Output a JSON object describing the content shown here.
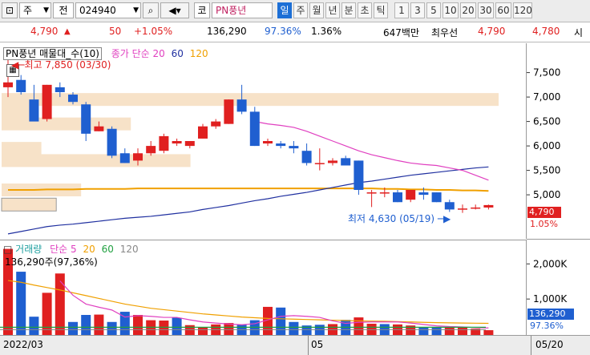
{
  "toolbar": {
    "mode": "주",
    "mode_alt": "전",
    "code": "024940",
    "market": "코",
    "name": "PN풍년",
    "periods": [
      "일",
      "주",
      "월",
      "년",
      "분",
      "초",
      "틱"
    ],
    "active_period": "일",
    "intervals": [
      "1",
      "3",
      "5",
      "10",
      "20",
      "30",
      "60",
      "120"
    ]
  },
  "info": {
    "price": "4,790",
    "change": "50",
    "change_pct": "+1.05%",
    "volume": "136,290",
    "vol_ratio": "97.36%",
    "turnover_pct": "1.36%",
    "amount": "647백만",
    "best_ask_label": "최우선",
    "ask": "4,790",
    "bid": "4,780",
    "more": "시"
  },
  "price_legend": {
    "title": "PN풍년 매물대_수(10)",
    "ma_label": "종가 단순",
    "ma_periods": [
      "20",
      "60",
      "120"
    ],
    "max_annotation": "최고 7,850 (03/30)",
    "min_annotation": "최저 4,630 (05/19)",
    "current_price": "4,790",
    "current_pct": "1.05%"
  },
  "volume_legend": {
    "title": "거래량",
    "ma_label": "단순",
    "ma_periods": [
      "5",
      "20",
      "60",
      "120"
    ],
    "value": "136,290주(97,36%)",
    "current": "136,290",
    "current_pct": "97.36%"
  },
  "dates": {
    "start": "2022/03",
    "mid": "05",
    "end": "05/20"
  },
  "colors": {
    "up": "#e02020",
    "down": "#1f5fd0",
    "ma20": "#e040c0",
    "ma60": "#2030a0",
    "ma120": "#f0a000",
    "profile": "#f7e2c8"
  },
  "chart_data": [
    {
      "type": "candlestick",
      "title": "PN풍년 매물대_수(10)",
      "ylim": [
        4100,
        8100
      ],
      "y_ticks": [
        7500,
        7000,
        6500,
        6000,
        5500,
        5000
      ],
      "candles": [
        {
          "o": 7200,
          "h": 7850,
          "l": 7000,
          "c": 7300
        },
        {
          "o": 7350,
          "h": 7450,
          "l": 7050,
          "c": 7100
        },
        {
          "o": 6950,
          "h": 7250,
          "l": 6950,
          "c": 6500
        },
        {
          "o": 6550,
          "h": 7250,
          "l": 6500,
          "c": 7250
        },
        {
          "o": 7200,
          "h": 7300,
          "l": 7000,
          "c": 7100
        },
        {
          "o": 7050,
          "h": 7100,
          "l": 6850,
          "c": 6900
        },
        {
          "o": 6850,
          "h": 6900,
          "l": 6100,
          "c": 6250
        },
        {
          "o": 6300,
          "h": 6500,
          "l": 6300,
          "c": 6400
        },
        {
          "o": 6350,
          "h": 6400,
          "l": 5750,
          "c": 5800
        },
        {
          "o": 5850,
          "h": 5950,
          "l": 5650,
          "c": 5650
        },
        {
          "o": 5700,
          "h": 5950,
          "l": 5600,
          "c": 5850
        },
        {
          "o": 5850,
          "h": 6100,
          "l": 5800,
          "c": 6000
        },
        {
          "o": 5900,
          "h": 6250,
          "l": 5850,
          "c": 6200
        },
        {
          "o": 6050,
          "h": 6150,
          "l": 6000,
          "c": 6100
        },
        {
          "o": 6000,
          "h": 6100,
          "l": 5950,
          "c": 6100
        },
        {
          "o": 6150,
          "h": 6450,
          "l": 6150,
          "c": 6400
        },
        {
          "o": 6400,
          "h": 6550,
          "l": 6350,
          "c": 6500
        },
        {
          "o": 6450,
          "h": 6950,
          "l": 6450,
          "c": 6950
        },
        {
          "o": 6950,
          "h": 7250,
          "l": 6650,
          "c": 6700
        },
        {
          "o": 6700,
          "h": 6800,
          "l": 6000,
          "c": 6000
        },
        {
          "o": 6050,
          "h": 6150,
          "l": 6000,
          "c": 6100
        },
        {
          "o": 6050,
          "h": 6100,
          "l": 5950,
          "c": 6000
        },
        {
          "o": 6000,
          "h": 6100,
          "l": 5850,
          "c": 5950
        },
        {
          "o": 5900,
          "h": 6050,
          "l": 5600,
          "c": 5650
        },
        {
          "o": 5650,
          "h": 5950,
          "l": 5500,
          "c": 5650
        },
        {
          "o": 5650,
          "h": 5750,
          "l": 5600,
          "c": 5700
        },
        {
          "o": 5750,
          "h": 5800,
          "l": 5600,
          "c": 5600
        },
        {
          "o": 5700,
          "h": 5700,
          "l": 5000,
          "c": 5100
        },
        {
          "o": 5050,
          "h": 5100,
          "l": 4750,
          "c": 5050
        },
        {
          "o": 5050,
          "h": 5150,
          "l": 4950,
          "c": 5050
        },
        {
          "o": 5050,
          "h": 5100,
          "l": 4850,
          "c": 4850
        },
        {
          "o": 4900,
          "h": 5100,
          "l": 4850,
          "c": 5100
        },
        {
          "o": 5050,
          "h": 5150,
          "l": 4900,
          "c": 5000
        },
        {
          "o": 5050,
          "h": 5050,
          "l": 4850,
          "c": 4850
        },
        {
          "o": 4850,
          "h": 4900,
          "l": 4650,
          "c": 4700
        },
        {
          "o": 4700,
          "h": 4800,
          "l": 4630,
          "c": 4720
        },
        {
          "o": 4720,
          "h": 4800,
          "l": 4700,
          "c": 4740
        },
        {
          "o": 4740,
          "h": 4800,
          "l": 4700,
          "c": 4790
        }
      ],
      "ma20": [
        null,
        null,
        null,
        null,
        null,
        null,
        null,
        null,
        null,
        null,
        null,
        null,
        null,
        null,
        null,
        null,
        null,
        null,
        null,
        6500,
        6450,
        6420,
        6380,
        6300,
        6200,
        6100,
        6000,
        5900,
        5820,
        5760,
        5700,
        5650,
        5620,
        5600,
        5550,
        5500,
        5400,
        5300
      ],
      "ma60": [
        4200,
        4250,
        4300,
        4350,
        4380,
        4400,
        4430,
        4460,
        4490,
        4520,
        4540,
        4560,
        4590,
        4620,
        4650,
        4700,
        4740,
        4780,
        4830,
        4880,
        4920,
        4970,
        5010,
        5050,
        5100,
        5150,
        5200,
        5250,
        5280,
        5320,
        5360,
        5400,
        5430,
        5460,
        5490,
        5520,
        5550,
        5570
      ],
      "ma120": [
        5100,
        5100,
        5100,
        5110,
        5110,
        5110,
        5120,
        5120,
        5120,
        5120,
        5130,
        5130,
        5130,
        5130,
        5130,
        5130,
        5130,
        5130,
        5130,
        5130,
        5130,
        5130,
        5130,
        5130,
        5130,
        5130,
        5130,
        5130,
        5130,
        5120,
        5120,
        5110,
        5110,
        5100,
        5100,
        5090,
        5090,
        5080
      ],
      "volume_profile": [
        {
          "price": 6950,
          "weight": 1.0
        },
        {
          "price": 6700,
          "weight": 0.06
        },
        {
          "price": 6450,
          "weight": 0.26
        },
        {
          "price": 5950,
          "weight": 0.08
        },
        {
          "price": 5700,
          "weight": 0.38
        },
        {
          "price": 5100,
          "weight": 0.16
        },
        {
          "price": 4800,
          "weight": 0.11
        }
      ]
    },
    {
      "type": "bar",
      "title": "거래량",
      "ylim": [
        0,
        2600
      ],
      "y_ticks": [
        2000,
        1000
      ],
      "y_tick_labels": [
        "2,000K",
        "1,000K"
      ],
      "values": [
        2450,
        1800,
        520,
        1200,
        1750,
        370,
        570,
        580,
        370,
        660,
        570,
        420,
        410,
        490,
        280,
        220,
        300,
        340,
        300,
        420,
        800,
        780,
        370,
        270,
        290,
        310,
        430,
        500,
        320,
        310,
        300,
        270,
        210,
        230,
        220,
        210,
        180,
        136
      ],
      "up": [
        true,
        false,
        false,
        true,
        true,
        false,
        false,
        true,
        false,
        false,
        true,
        true,
        true,
        false,
        true,
        true,
        true,
        true,
        false,
        false,
        true,
        false,
        false,
        false,
        false,
        true,
        false,
        true,
        true,
        false,
        true,
        true,
        false,
        false,
        true,
        true,
        true,
        true
      ],
      "ma5": [
        null,
        null,
        null,
        null,
        1540,
        1130,
        880,
        790,
        710,
        510,
        550,
        530,
        500,
        500,
        430,
        370,
        340,
        310,
        290,
        320,
        430,
        530,
        550,
        530,
        500,
        400,
        330,
        360,
        370,
        370,
        370,
        340,
        300,
        260,
        240,
        230,
        210,
        200
      ],
      "ma20": [
        1550,
        1500,
        1420,
        1350,
        1280,
        1200,
        1120,
        1040,
        960,
        880,
        820,
        760,
        720,
        680,
        640,
        600,
        570,
        540,
        510,
        490,
        470,
        460,
        450,
        440,
        430,
        420,
        410,
        400,
        395,
        390,
        380,
        370,
        360,
        350,
        345,
        340,
        335,
        330
      ],
      "ma60": [
        null,
        null,
        null,
        null,
        null,
        null,
        null,
        null,
        null,
        null,
        null,
        null,
        null,
        null,
        null,
        null,
        null,
        null,
        null,
        null,
        null,
        null,
        null,
        null,
        null,
        null,
        null,
        null,
        null,
        null,
        null,
        null,
        null,
        null,
        null,
        null,
        null,
        null
      ],
      "ma120": [
        null,
        null,
        null,
        null,
        null,
        null,
        null,
        null,
        null,
        null,
        null,
        null,
        null,
        null,
        null,
        null,
        null,
        null,
        null,
        null,
        null,
        null,
        null,
        null,
        null,
        null,
        null,
        null,
        null,
        null,
        null,
        null,
        null,
        null,
        null,
        null,
        null,
        null
      ]
    }
  ]
}
